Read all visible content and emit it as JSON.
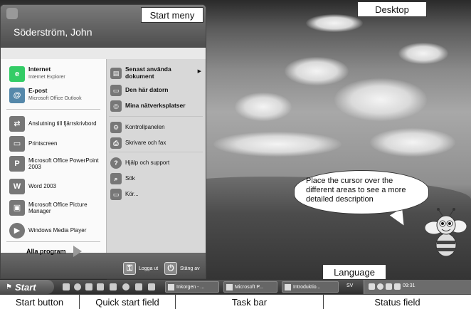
{
  "labels": {
    "start_menu": "Start meny",
    "desktop": "Desktop",
    "language": "Language"
  },
  "bottom_labels": [
    "Start button",
    "Quick start field",
    "Task bar",
    "Status field"
  ],
  "start_menu": {
    "user_name": "Söderström, John",
    "pinned": [
      {
        "title": "Internet",
        "subtitle": "Internet Explorer",
        "icon": "internet-explorer-icon"
      },
      {
        "title": "E-post",
        "subtitle": "Microsoft Office Outlook",
        "icon": "outlook-icon"
      }
    ],
    "recent": [
      {
        "label": "Anslutning till fjärrskrivbord",
        "icon": "remote-desktop-icon"
      },
      {
        "label": "Printscreen",
        "icon": "printscreen-icon"
      },
      {
        "label": "Microsoft Office PowerPoint 2003",
        "icon": "powerpoint-icon"
      },
      {
        "label": "Word 2003",
        "icon": "word-icon"
      },
      {
        "label": "Microsoft Office Picture Manager",
        "icon": "picture-manager-icon"
      },
      {
        "label": "Windows Media Player",
        "icon": "media-player-icon"
      }
    ],
    "all_programs": "Alla program",
    "right_bold": [
      {
        "label": "Senast använda dokument",
        "icon": "recent-documents-icon"
      },
      {
        "label": "Den här datorn",
        "icon": "my-computer-icon"
      },
      {
        "label": "Mina nätverksplatser",
        "icon": "network-places-icon"
      }
    ],
    "right_regular": [
      {
        "label": "Kontrollpanelen",
        "icon": "control-panel-icon"
      },
      {
        "label": "Skrivare och fax",
        "icon": "printers-icon"
      }
    ],
    "right_tools": [
      {
        "label": "Hjälp och support",
        "icon": "help-icon"
      },
      {
        "label": "Sök",
        "icon": "search-icon"
      },
      {
        "label": "Kör...",
        "icon": "run-icon"
      }
    ],
    "logoff": "Logga ut",
    "shutdown": "Stäng av"
  },
  "taskbar": {
    "start_label": "Start",
    "tasks": [
      "Inkorgen - ...",
      "Microsoft P...",
      "Introduktio..."
    ],
    "language": "SV",
    "clock": "09:31"
  },
  "bubble_text": "Place the cursor over the different areas to see a more detailed description"
}
